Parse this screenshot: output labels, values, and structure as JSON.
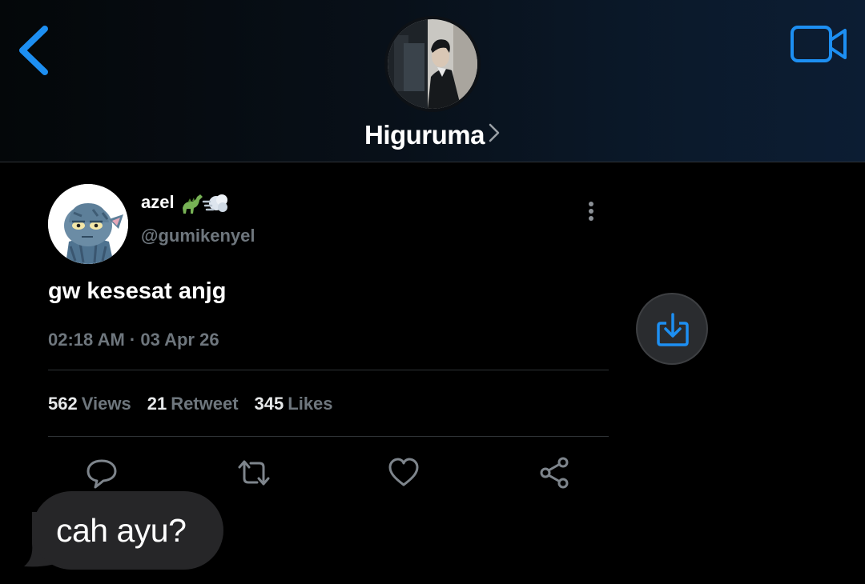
{
  "header": {
    "contact_name": "Higuruma",
    "icons": {
      "back": "chevron-left-icon",
      "video": "video-camera-icon",
      "name_chevron": "chevron-right-icon"
    }
  },
  "tweet": {
    "display_name": "azel",
    "emojis": "🦕💨",
    "handle": "@gumikenyel",
    "text": "gw kesesat anjg",
    "timestamp": "02:18 AM · 03 Apr 26",
    "stats": [
      {
        "value": "562",
        "label": "Views"
      },
      {
        "value": "21",
        "label": "Retweet"
      },
      {
        "value": "345",
        "label": "Likes"
      }
    ],
    "actions": [
      "reply-icon",
      "retweet-icon",
      "like-icon",
      "share-icon"
    ]
  },
  "message": {
    "text": "cah ayu?"
  },
  "colors": {
    "accent": "#1d9bf0",
    "muted": "#6e767d",
    "bubble": "#262628",
    "background": "#000000"
  }
}
